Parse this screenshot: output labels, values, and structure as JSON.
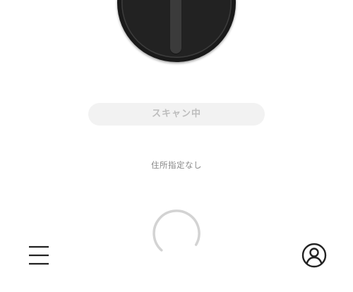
{
  "device": {
    "icon": "smart-lock-icon"
  },
  "status": {
    "label": "スキャン中"
  },
  "address": {
    "label": "住所指定なし"
  },
  "loading": {
    "icon": "loading-spinner-icon"
  },
  "nav": {
    "menu_icon": "hamburger-menu-icon",
    "profile_icon": "user-account-icon"
  },
  "colors": {
    "device_body": "#1a1a1a",
    "pill_background": "#f2f2f2",
    "pill_text": "#bdbdbd",
    "secondary_text": "#888888",
    "icon_stroke": "#222222",
    "spinner": "#d3d3d3"
  }
}
